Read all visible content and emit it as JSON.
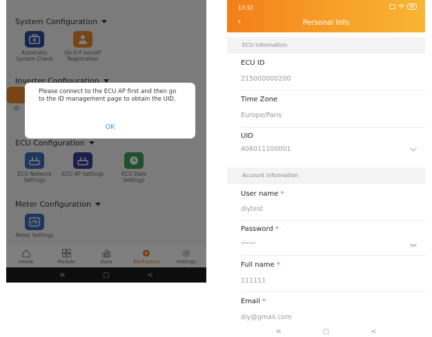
{
  "left": {
    "sections": {
      "system": "System Configuration",
      "inverter": "Inverter Configuration",
      "ecu": "ECU Configuration",
      "meter": "Meter Configuration"
    },
    "tiles": {
      "auto_check": "Automatic System Check",
      "diy_reg": "Do-it-Y ourself Registration",
      "id_partial": "ID",
      "ecu_network": "ECU Network Settings",
      "ecu_ap": "ECU AP Settings",
      "ecu_date": "ECU Date Settings",
      "meter_settings": "Meter Settings"
    },
    "tabs": [
      "Home",
      "Module",
      "Data",
      "Workspace",
      "Settings"
    ],
    "active_tab": "Workspace",
    "dialog": {
      "message": "Please connect to the ECU AP first and then go to the ID management page to obtain the UID.",
      "ok": "OK"
    },
    "sysnav": {
      "menu": "≡",
      "home": "▢",
      "back": "<"
    }
  },
  "right": {
    "time": "13:32",
    "battery": "88",
    "title": "Personal Info",
    "ecu_header": "ECU information",
    "account_header": "Account information",
    "fields": {
      "ecu_id": {
        "label": "ECU ID",
        "value": "215000000200"
      },
      "time_zone": {
        "label": "Time Zone",
        "value": "Europe/Paris"
      },
      "uid": {
        "label": "UID",
        "value": "406011100001"
      },
      "user_name": {
        "label": "User name",
        "value": "diytest"
      },
      "password": {
        "label": "Password",
        "value": "••••••"
      },
      "full_name": {
        "label": "Full name",
        "value": "111111"
      },
      "email": {
        "label": "Email",
        "value": "diy@gmail.com"
      }
    },
    "required_mark": "*",
    "sysnav": {
      "menu": "≡",
      "home": "▢",
      "back": "<"
    }
  },
  "colors": {
    "accent_orange": "#f47e18",
    "dialog_ok": "#2b8fe0",
    "required": "#e64a3b"
  }
}
